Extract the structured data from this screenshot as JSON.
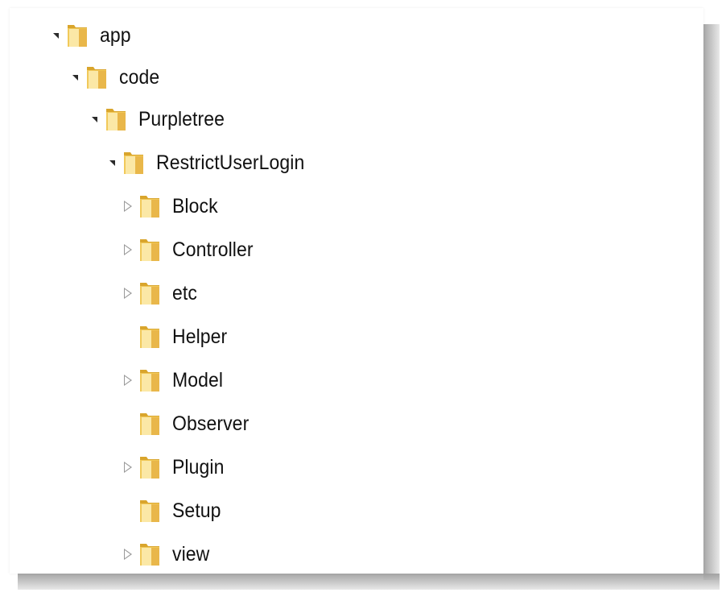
{
  "tree": {
    "nodes": [
      {
        "label": "app",
        "toggle": "expanded",
        "icon": "folder-icon"
      },
      {
        "label": "code",
        "toggle": "expanded",
        "icon": "folder-icon"
      },
      {
        "label": "Purpletree",
        "toggle": "expanded",
        "icon": "folder-icon"
      },
      {
        "label": "RestrictUserLogin",
        "toggle": "expanded",
        "icon": "folder-icon"
      },
      {
        "label": "Block",
        "toggle": "collapsed",
        "icon": "folder-icon"
      },
      {
        "label": "Controller",
        "toggle": "collapsed",
        "icon": "folder-icon"
      },
      {
        "label": "etc",
        "toggle": "collapsed",
        "icon": "folder-icon"
      },
      {
        "label": "Helper",
        "toggle": "none",
        "icon": "folder-icon"
      },
      {
        "label": "Model",
        "toggle": "collapsed",
        "icon": "folder-icon"
      },
      {
        "label": "Observer",
        "toggle": "none",
        "icon": "folder-icon"
      },
      {
        "label": "Plugin",
        "toggle": "collapsed",
        "icon": "folder-icon"
      },
      {
        "label": "Setup",
        "toggle": "none",
        "icon": "folder-icon"
      },
      {
        "label": "view",
        "toggle": "collapsed",
        "icon": "folder-icon"
      }
    ]
  },
  "colors": {
    "folder_light": "#fbe8a6",
    "folder_mid": "#f1c95a",
    "folder_dark": "#d9a52c",
    "text": "#111111"
  }
}
